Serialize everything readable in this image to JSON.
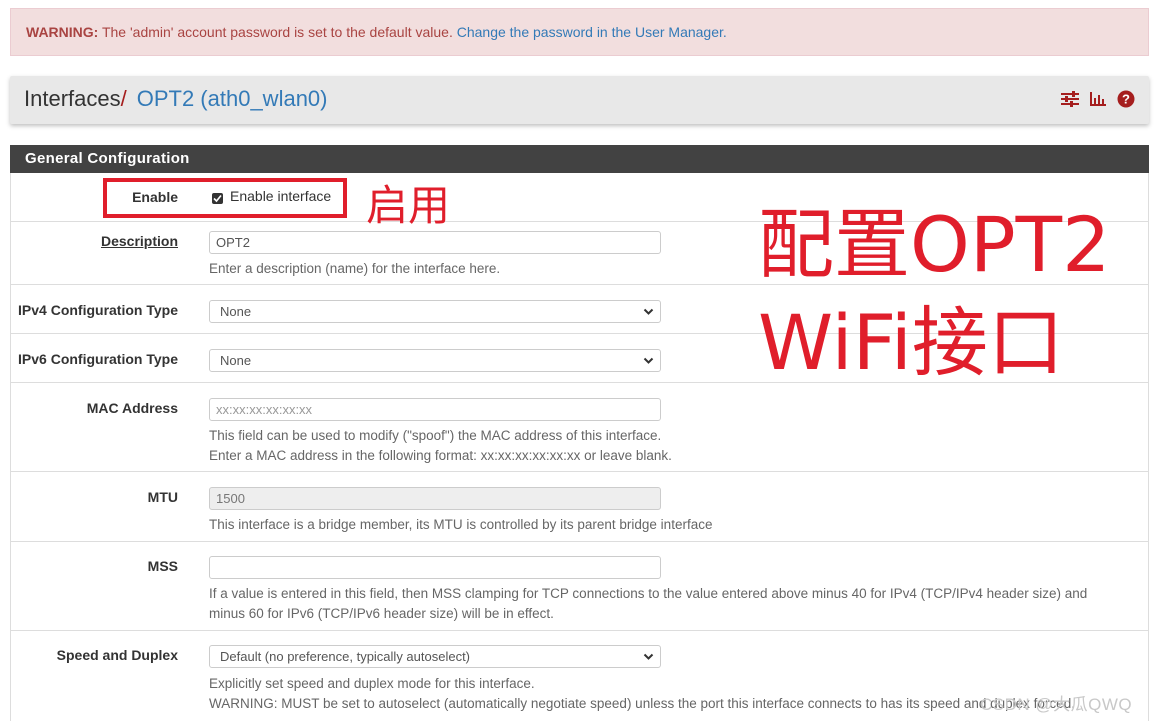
{
  "warning": {
    "prefix": "WARNING:",
    "message": " The 'admin' account password is set to the default value. ",
    "link": "Change the password in the User Manager."
  },
  "breadcrumb": {
    "root": "Interfaces",
    "separator": "/",
    "current": "OPT2 (ath0_wlan0)",
    "icons": [
      "sliders-icon",
      "bar-chart-icon",
      "help-icon"
    ]
  },
  "panel": {
    "title": "General Configuration"
  },
  "form": {
    "enable": {
      "label": "Enable",
      "checkbox_label": "Enable interface",
      "checked": true
    },
    "description": {
      "label": "Description",
      "value": "OPT2",
      "help": "Enter a description (name) for the interface here."
    },
    "ipv4": {
      "label": "IPv4 Configuration Type",
      "value": "None"
    },
    "ipv6": {
      "label": "IPv6 Configuration Type",
      "value": "None"
    },
    "mac": {
      "label": "MAC Address",
      "placeholder": "xx:xx:xx:xx:xx:xx",
      "help1": "This field can be used to modify (\"spoof\") the MAC address of this interface.",
      "help2": "Enter a MAC address in the following format: xx:xx:xx:xx:xx:xx or leave blank."
    },
    "mtu": {
      "label": "MTU",
      "value": "1500",
      "help": "This interface is a bridge member, its MTU is controlled by its parent bridge interface"
    },
    "mss": {
      "label": "MSS",
      "value": "",
      "help1": "If a value is entered in this field, then MSS clamping for TCP connections to the value entered above minus 40 for IPv4 (TCP/IPv4 header size) and",
      "help2": "minus 60 for IPv6 (TCP/IPv6 header size) will be in effect."
    },
    "speed": {
      "label": "Speed and Duplex",
      "value": "Default (no preference, typically autoselect)",
      "help1": "Explicitly set speed and duplex mode for this interface.",
      "help2": "WARNING: MUST be set to autoselect (automatically negotiate speed) unless the port this interface connects to has its speed and duplex forced."
    }
  },
  "annotations": {
    "enable_note": "启用",
    "title_line1": "配置OPT2",
    "title_line2": "WiFi接口",
    "color": "#e01e2b"
  },
  "watermark": "CSDN @大瓜QWQ"
}
